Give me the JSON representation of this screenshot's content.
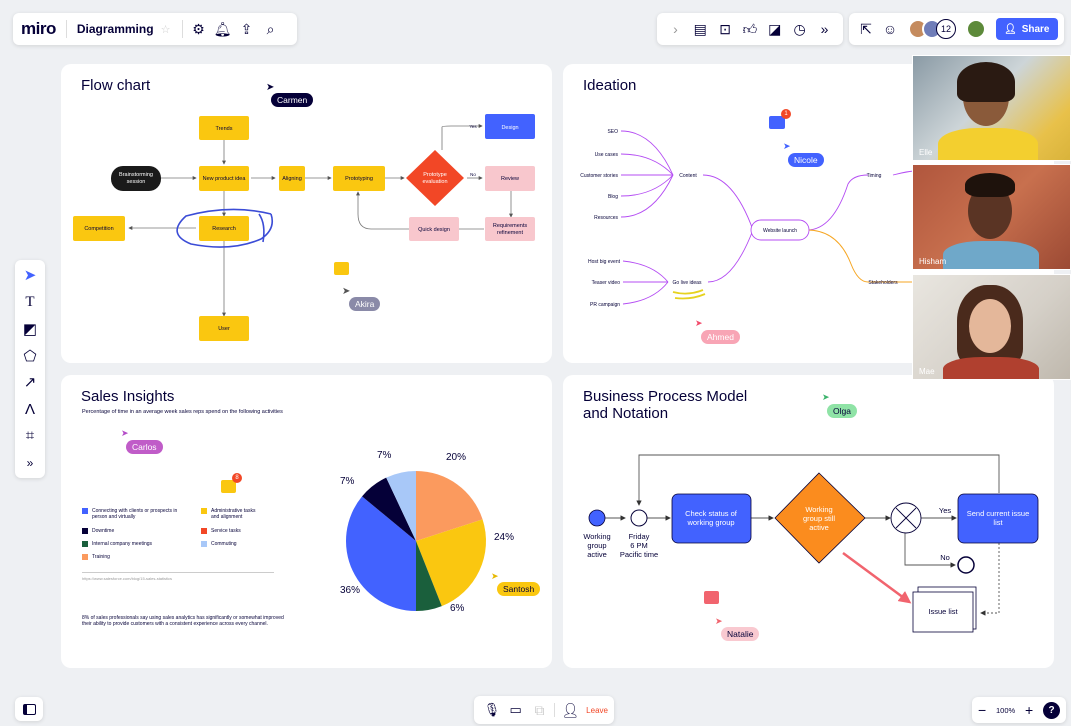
{
  "app": {
    "logo": "miro",
    "board_name": "Diagramming",
    "share_label": "Share",
    "collab_count": "12"
  },
  "icons": {
    "star": "star-icon",
    "settings": "settings-icon",
    "bell": "bell-icon",
    "upload": "upload-icon",
    "search": "search-icon"
  },
  "flow": {
    "title": "Flow chart",
    "nodes": {
      "trends": "Trends",
      "brainstorm1": "Brainstorming",
      "brainstorm2": "session",
      "newidea": "New product idea",
      "aligning": "Aligning",
      "prototyping": "Prototyping",
      "proto1": "Prototype",
      "proto2": "evaluation",
      "design": "Design",
      "review": "Review",
      "req1": "Requirements",
      "req2": "refinement",
      "quick": "Quick design",
      "research": "Research",
      "competition": "Competition",
      "user": "User",
      "yes": "Yes",
      "no": "No"
    },
    "cursors": {
      "carmen": "Carmen",
      "akira": "Akira"
    }
  },
  "ideation": {
    "title": "Ideation",
    "leaves_top": [
      "SEO",
      "Use cases",
      "Customer stories",
      "Blog",
      "Resources"
    ],
    "content": "Content",
    "launch": "Website launch",
    "timing": "Timing",
    "stakeholders": "Stakeholders",
    "golive": "Go live ideas",
    "leaves_bottom": [
      "Host big event",
      "Teaser video",
      "PR campaign"
    ],
    "cursors": {
      "nicole": "Nicole",
      "ahmed": "Ahmed"
    },
    "comment_badge": "1"
  },
  "sales": {
    "title": "Sales Insights",
    "subtitle": "Percentage of time in an average week sales reps spend on the following activities",
    "legend_left": [
      "Connecting with clients or prospects in person and virtually",
      "Downtime",
      "Internal company meetings",
      "Training"
    ],
    "legend_right": [
      "Administrative tasks and alignment",
      "Service tasks",
      "Commuting"
    ],
    "colors": {
      "connecting": "#4262ff",
      "admin": "#fac710",
      "downtime": "#050038",
      "service": "#f24726",
      "internal": "#1a5f3c",
      "commuting": "#a8c8f8",
      "training": "#fb9a5e"
    },
    "source": "https://www.salesforce.com/blog/15-sales-statistics",
    "note": "8% of sales professionals say using sales analytics has significantly or somewhat improved their ability to provide customers with a consistent experience across every channel.",
    "labels": {
      "a": "7%",
      "b": "20%",
      "c": "7%",
      "d": "24%",
      "e": "36%",
      "f": "6%"
    },
    "cursors": {
      "carlos": "Carlos",
      "santosh": "Santosh"
    },
    "comment_badge": "8"
  },
  "chart_data": {
    "type": "pie",
    "slices": [
      {
        "label": "20%",
        "value": 20,
        "color": "#fb9a5e"
      },
      {
        "label": "24%",
        "value": 24,
        "color": "#fac710"
      },
      {
        "label": "6%",
        "value": 6,
        "color": "#1a5f3c"
      },
      {
        "label": "36%",
        "value": 36,
        "color": "#4262ff"
      },
      {
        "label": "7%",
        "value": 7,
        "color": "#050038"
      },
      {
        "label": "7%",
        "value": 7,
        "color": "#a8c8f8"
      }
    ]
  },
  "bpmn": {
    "title1": "Business Process Model",
    "title2": "and Notation",
    "start1": "Working",
    "start2": "group",
    "start3": "active",
    "timer1": "Friday",
    "timer2": "6 PM",
    "timer3": "Pacific time",
    "check1": "Check status of",
    "check2": "working group",
    "still1": "Working",
    "still2": "group still",
    "still3": "active",
    "yes": "Yes",
    "no": "No",
    "send1": "Send current issue",
    "send2": "list",
    "issue": "Issue list",
    "cursors": {
      "olga": "Olga",
      "natalie": "Natalie"
    }
  },
  "video": {
    "p1": "Elle",
    "p2": "Hisham",
    "p3": "Mae"
  },
  "bottom": {
    "leave": "Leave",
    "zoom": "100%",
    "help": "?"
  }
}
